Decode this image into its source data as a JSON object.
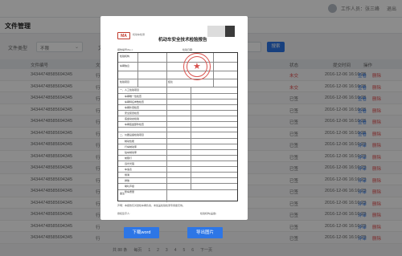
{
  "header": {
    "user_label": "工作人员：张三峰",
    "logout": "退出"
  },
  "page_title": "文件管理",
  "filter": {
    "label_type": "文件类型",
    "type_value": "不限",
    "label_second": "文",
    "search_button": "搜索"
  },
  "table": {
    "headers": [
      "文件编号",
      "文",
      "状态",
      "提交时间",
      "操作"
    ],
    "rows": [
      {
        "num": "34344748585694345",
        "type": "行",
        "status": "未交",
        "time": "2016-12-06 16:16:23",
        "a1": "查看",
        "a2": "删除"
      },
      {
        "num": "34344748585694345",
        "type": "行",
        "status": "未交",
        "time": "2016-12-06 16:16:23",
        "a1": "查看",
        "a2": "删除"
      },
      {
        "num": "34344748585694345",
        "type": "行",
        "status": "已签",
        "time": "2016-12-06 16:16:23",
        "a1": "查看",
        "a2": "删除"
      },
      {
        "num": "34344748585694345",
        "type": "行",
        "status": "已签",
        "time": "2016-12-06 16:16:23",
        "a1": "查看",
        "a2": "删除"
      },
      {
        "num": "34344748585694345",
        "type": "行",
        "status": "已签",
        "time": "2016-12-06 16:16:23",
        "a1": "查看",
        "a2": "删除"
      },
      {
        "num": "34344748585694345",
        "type": "行",
        "status": "已签",
        "time": "2016-12-06 16:16:23",
        "a1": "查看",
        "a2": "删除"
      },
      {
        "num": "34344748585694345",
        "type": "行",
        "status": "已签",
        "time": "2016-12-06 16:16:23",
        "a1": "评审",
        "a2": "删除"
      },
      {
        "num": "34344748585694345",
        "type": "行",
        "status": "已签",
        "time": "2016-12-06 16:16:23",
        "a1": "评审",
        "a2": "删除"
      },
      {
        "num": "34344748585694345",
        "type": "行",
        "status": "已签",
        "time": "2016-12-06 16:16:23",
        "a1": "评审",
        "a2": "删除"
      },
      {
        "num": "34344748585694345",
        "type": "行",
        "status": "已签",
        "time": "2016-12-06 16:16:23",
        "a1": "评审",
        "a2": "删除"
      },
      {
        "num": "34344748585694345",
        "type": "行",
        "status": "已签",
        "time": "2016-12-06 16:16:23",
        "a1": "评审",
        "a2": "删除"
      },
      {
        "num": "34344748585694345",
        "type": "行",
        "status": "已签",
        "time": "2016-12-06 16:16:23",
        "a1": "评审",
        "a2": "删除"
      },
      {
        "num": "34344748585694345",
        "type": "行",
        "status": "已签",
        "time": "2016-12-06 16:16:23",
        "a1": "评审",
        "a2": "删除"
      },
      {
        "num": "34344748585694345",
        "type": "行",
        "status": "已签",
        "time": "2016-12-06 16:16:23",
        "a1": "评审",
        "a2": "删除"
      },
      {
        "num": "34344748585694345",
        "type": "行",
        "status": "已签",
        "time": "2016-12-06 16:16:23",
        "a1": "评审",
        "a2": "删除"
      }
    ]
  },
  "pager": [
    "共 88 条",
    "每页",
    "1",
    "2",
    "3",
    "4",
    "5",
    "6",
    "下一页"
  ],
  "modal": {
    "logo": "MA",
    "logo_sub": "机动车检测",
    "doc_title": "机动车安全技术检验报告",
    "meta_left": "报告编号(No.):",
    "meta_right": "检验日期:",
    "cells": {
      "r1": "检验机构",
      "r2": "车辆信息",
      "r3": "检验项目",
      "r4": "结论",
      "section_a": "一、人工检验项目",
      "section_b": "二、仪器设备检验项目",
      "items": [
        "车辆唯一性检查",
        "车辆特征参数检查",
        "车辆外观检查",
        "安全装置检查",
        "底盘动态检验",
        "车辆底盘部件检查"
      ],
      "items2": [
        "制动性能",
        "行车制动率",
        "驻车制动率",
        "前照灯",
        "远光光强",
        "车速表",
        "侧滑",
        "排放",
        "喇叭声级",
        "整车质量"
      ],
      "remark": "备注"
    },
    "footnote": "声明：本报告仅对送检车辆负责，未加盖检验检测专用章无效。",
    "sign_left": "授权签字人:",
    "sign_right": "检验机构(盖章)",
    "button_word": "下载word",
    "button_image": "导出图片"
  }
}
